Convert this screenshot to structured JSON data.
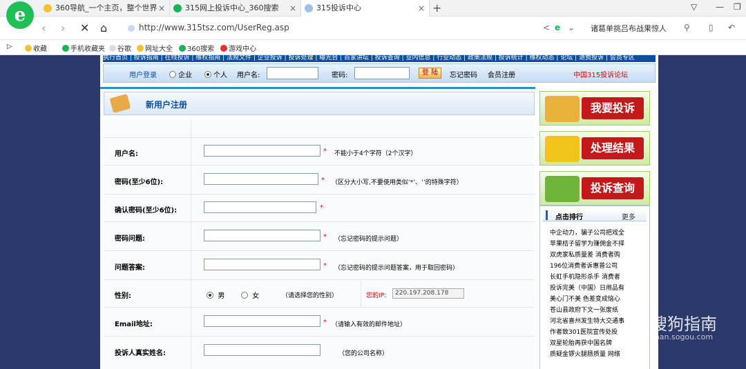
{
  "browser": {
    "tabs": [
      {
        "label": "360导航_一个主页，整个世界",
        "color": "#f2c230"
      },
      {
        "label": "315网上投诉中心_360搜索",
        "color": "#19b358"
      },
      {
        "label": "315投诉中心",
        "color": "#9ec1ea",
        "active": true
      }
    ],
    "new_tab": "+",
    "url": "http://www.315tsz.com/UserReg.asp",
    "search_text": "诸葛单挑吕布战果惊人",
    "bookmarks": [
      "收藏",
      "手机收藏夹",
      "谷歌",
      "网址大全",
      "360搜索",
      "游戏中心"
    ]
  },
  "site": {
    "nav_strip": "执行首页 | 投诉指南 | 在线投诉 | 维权指南 | 法规文件 | 企业投诉 | 投诉处理 | 曝光台 | 百家讲坛 | 投诉查询 | 业内信息 | 行业动态 | 政策法规 | 投诉统计 | 维权动态 | 论坛 | 退费投诉 | 会员专区",
    "login": {
      "title": "用户登录",
      "opt_company": "企业",
      "opt_personal": "个人",
      "username_label": "用户名:",
      "password_label": "密码:",
      "login_btn": "登 陆",
      "forgot": "忘记密码",
      "register": "会员注册",
      "forum": "中国315投诉论坛"
    },
    "form_title": "新用户注册",
    "form": {
      "rows": [
        {
          "label": "用户名:",
          "hint": "不能小于4个字符（2个汉字）"
        },
        {
          "label": "密码(至少6位):",
          "hint": "（区分大小写,不要使用类似‘*’、‘’的特殊字符）"
        },
        {
          "label": "确认密码(至少6位):",
          "hint": ""
        },
        {
          "label": "密码问题:",
          "hint": "（忘记密码的提示问题）"
        },
        {
          "label": "问题答案:",
          "hint": "（忘记密码的提示问题答案，用于取回密码）"
        },
        {
          "label": "性别:",
          "hint": ""
        },
        {
          "label": "Email地址:",
          "hint": "（请输入有效的邮件地址）"
        },
        {
          "label": "投诉人真实姓名:",
          "hint": "（您的公司名称）"
        }
      ],
      "gender_male": "男",
      "gender_female": "女",
      "gender_hint": "（请选择您的性别）",
      "ip_label": "您的IP:",
      "ip_value": "220.197.208.178"
    },
    "side": {
      "complain": "我要投诉",
      "results": "处理结果",
      "query": "投诉查询",
      "rank_title": "点击排行",
      "rank_more": "更多",
      "rank_items": [
        "中企动力，骗子公司把戏全",
        "苹果桔子留学为赚佣金不择",
        "双虎家私质量差 消费者购",
        "196位消费者诉惠普公司",
        "长虹手机隐形杀手 消费者",
        "投诉完美（中国）日用品有",
        "美心门不美 色差变成恼心",
        "苍山县政府下文一张废纸",
        "河北省喜州发生特大交通事",
        "作者致301医院宣传处投",
        "双星轮胎再获中国名牌",
        "质疑金锣火腿肠质量 网络"
      ]
    }
  },
  "watermark": {
    "text": "搜狗指南",
    "sub": "zhinan.sogou.com"
  }
}
